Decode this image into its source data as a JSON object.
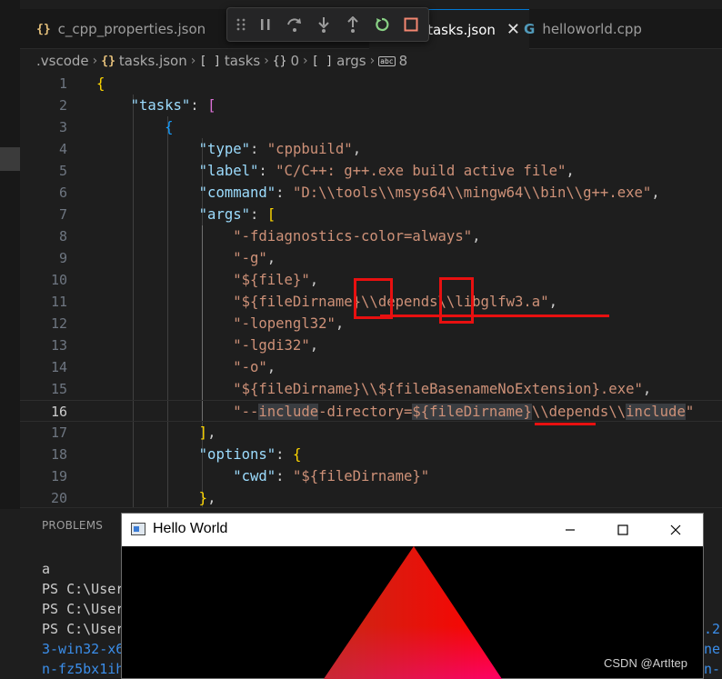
{
  "tabs": [
    {
      "icon": "{}",
      "label": "c_cpp_properties.json"
    },
    {
      "label": "tasks.json",
      "active": true
    },
    {
      "icon": "G",
      "label": "helloworld.cpp"
    }
  ],
  "tab_close": "✕",
  "breadcrumb": [
    {
      "icon": "",
      "label": ".vscode"
    },
    {
      "icon": "{}",
      "label": "tasks.json"
    },
    {
      "icon": "[ ]",
      "label": "tasks"
    },
    {
      "icon": "{}",
      "label": "0"
    },
    {
      "icon": "[ ]",
      "label": "args"
    },
    {
      "icon": "abc",
      "label": "8"
    }
  ],
  "editor": {
    "line_numbers": [
      "1",
      "2",
      "3",
      "4",
      "5",
      "6",
      "7",
      "8",
      "9",
      "10",
      "11",
      "12",
      "13",
      "14",
      "15",
      "16",
      "17",
      "18",
      "19",
      "20"
    ],
    "current_line": "16",
    "tokens": {
      "l1_open": "{",
      "l2_key": "\"tasks\"",
      "l2_colon": ": ",
      "l2_open": "[",
      "l3_open": "{",
      "l4_key": "\"type\"",
      "l4_colon": ": ",
      "l4_val": "\"cppbuild\"",
      "l4_comma": ",",
      "l5_key": "\"label\"",
      "l5_colon": ": ",
      "l5_val": "\"C/C++: g++.exe build active file\"",
      "l5_comma": ",",
      "l6_key": "\"command\"",
      "l6_colon": ": ",
      "l6_val": "\"D:\\\\tools\\\\msys64\\\\mingw64\\\\bin\\\\g++.exe\"",
      "l6_comma": ",",
      "l7_key": "\"args\"",
      "l7_colon": ": ",
      "l7_open": "[",
      "l8_val": "\"-fdiagnostics-color=always\"",
      "l8_comma": ",",
      "l9_val": "\"-g\"",
      "l9_comma": ",",
      "l10_val": "\"${file}\"",
      "l10_comma": ",",
      "l11_val": "\"${fileDirname}\\\\depends\\\\libglfw3.a\"",
      "l11_comma": ",",
      "l12_val": "\"-lopengl32\"",
      "l12_comma": ",",
      "l13_val": "\"-lgdi32\"",
      "l13_comma": ",",
      "l14_val": "\"-o\"",
      "l14_comma": ",",
      "l15_val": "\"${fileDirname}\\\\${fileBasenameNoExtension}.exe\"",
      "l15_comma": ",",
      "l16_a": "\"--",
      "l16_b": "include",
      "l16_c": "-directory=",
      "l16_d": "${fileDirname}",
      "l16_e": "\\\\depends\\\\",
      "l16_f": "include",
      "l16_g": "\"",
      "l17_close": "]",
      "l17_comma": ",",
      "l18_key": "\"options\"",
      "l18_colon": ": ",
      "l18_open": "{",
      "l19_key": "\"cwd\"",
      "l19_colon": ": ",
      "l19_val": "\"${fileDirname}\"",
      "l20_close": "}",
      "l20_comma": ","
    }
  },
  "panel": {
    "tab_label": "PROBLEMS",
    "terminal_lines": [
      "a",
      "PS C:\\User",
      "PS C:\\User",
      "PS C:\\User"
    ],
    "terminal_wrapped": [
      "3-win32-x6",
      "n-fz5bx1ih"
    ],
    "terminal_right": [
      ".2",
      "ne",
      "n-"
    ]
  },
  "window": {
    "title": "Hello World",
    "triangle_colors": {
      "top": "#ff0000",
      "bottom_right": "#ff0066",
      "bottom_left": "#b03a20"
    }
  },
  "watermark": "CSDN @ArtItep"
}
